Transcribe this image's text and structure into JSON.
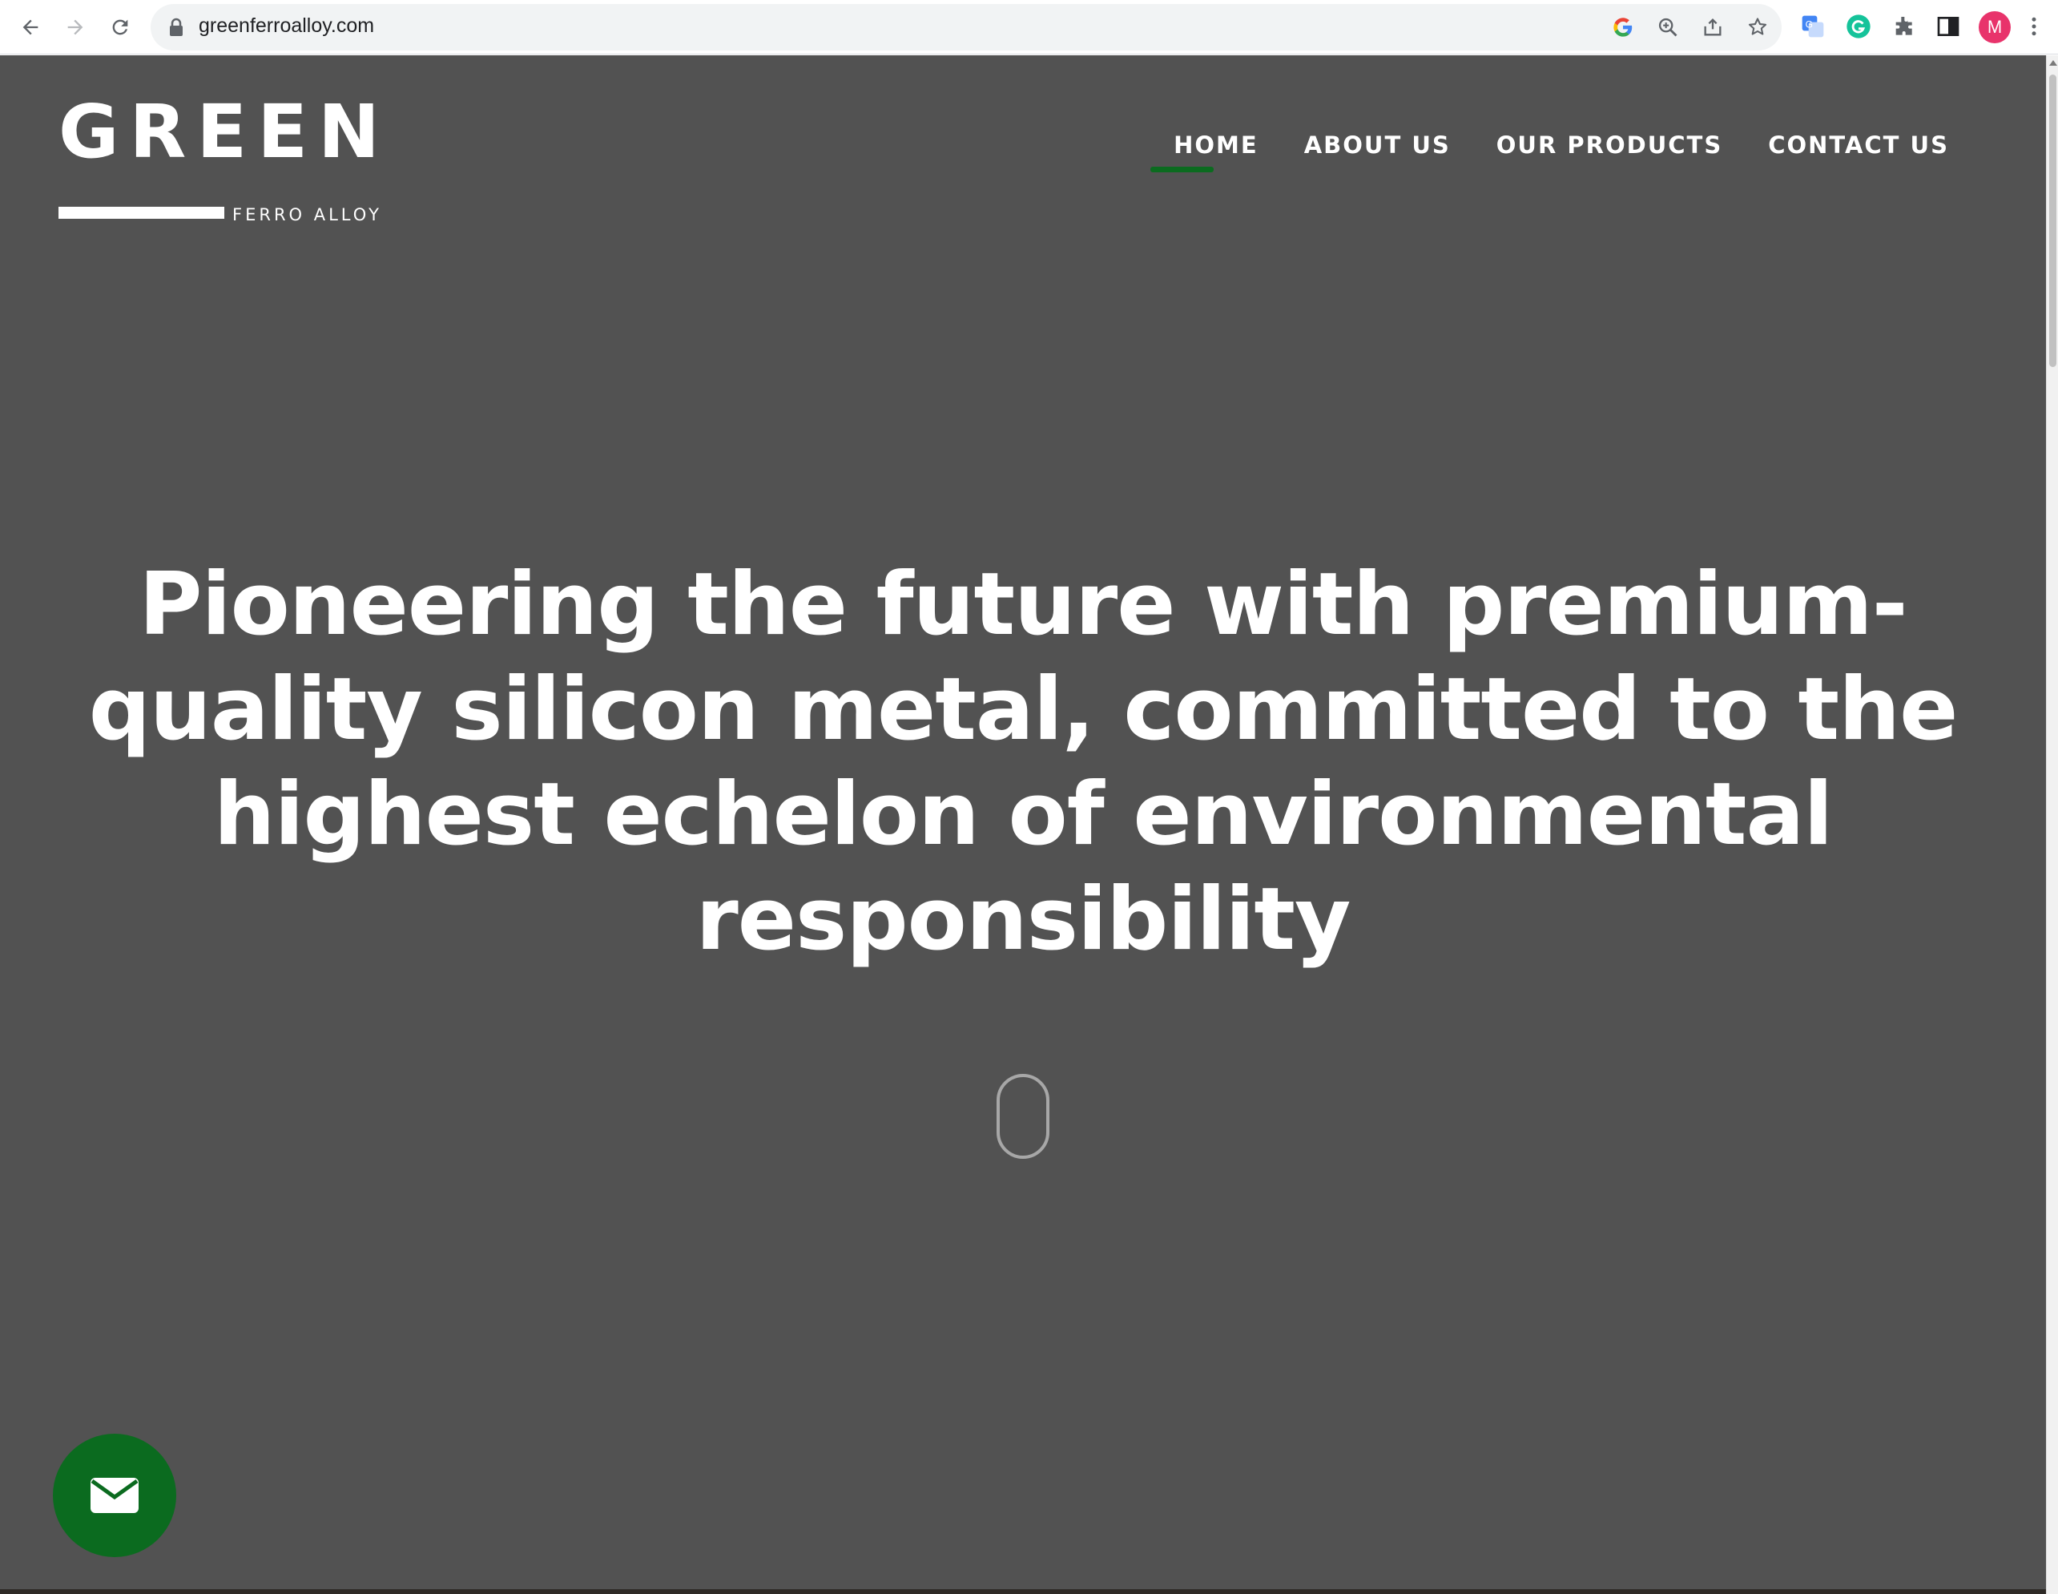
{
  "browser": {
    "url": "greenferroalloy.com",
    "profile_initial": "M",
    "icons": [
      "back-icon",
      "forward-icon",
      "reload-icon",
      "lock-icon",
      "google-icon",
      "zoom-icon",
      "share-icon",
      "bookmark-star-icon",
      "translate-icon",
      "grammarly-icon",
      "extensions-icon",
      "side-panel-icon",
      "menu-icon"
    ]
  },
  "site": {
    "logo": {
      "word": "GREEN",
      "subtitle": "FERRO ALLOY"
    },
    "nav": [
      {
        "label": "HOME",
        "active": true
      },
      {
        "label": "ABOUT US",
        "active": false
      },
      {
        "label": "OUR PRODUCTS",
        "active": false
      },
      {
        "label": "CONTACT US",
        "active": false
      }
    ],
    "hero": {
      "lines": [
        "Pioneering the future with premium-",
        "quality silicon metal, committed to the",
        "highest echelon of environmental",
        "responsibility"
      ]
    },
    "contact_button_icon": "envelope-icon"
  },
  "colors": {
    "page_background": "#525252",
    "accent_green": "#0b6b1f",
    "text_white": "#ffffff",
    "avatar": "#e8336b"
  }
}
